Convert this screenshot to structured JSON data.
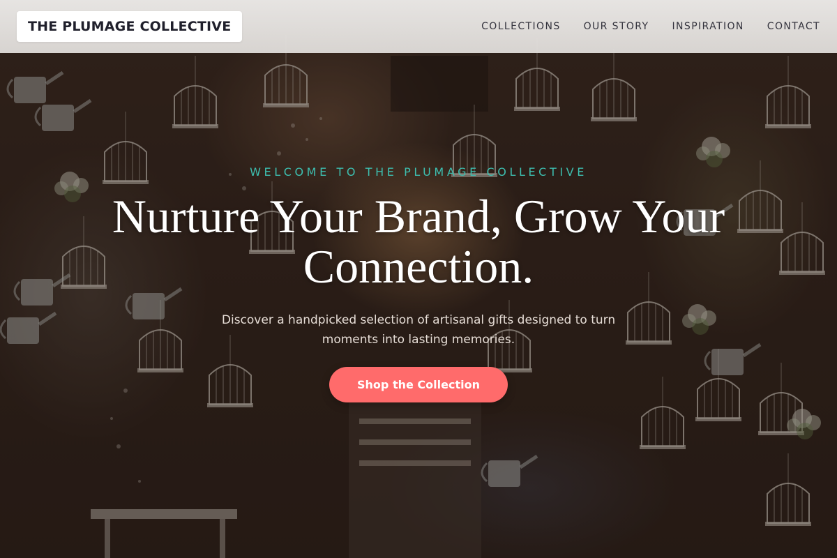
{
  "header": {
    "logo_text": "THE PLUMAGE COLLECTIVE",
    "nav": [
      {
        "label": "COLLECTIONS"
      },
      {
        "label": "OUR STORY"
      },
      {
        "label": "INSPIRATION"
      },
      {
        "label": "CONTACT"
      }
    ]
  },
  "hero": {
    "eyebrow": "WELCOME TO THE PLUMAGE COLLECTIVE",
    "headline": "Nurture Your Brand, Grow Your Connection.",
    "subtext": "Discover a handpicked selection of artisanal gifts designed to turn moments into lasting memories.",
    "cta_label": "Shop the Collection",
    "background_image": "shop-with-hanging-birdcages-and-watering-cans"
  },
  "colors": {
    "accent_teal": "#3dbfb0",
    "cta_coral": "#ff6b6b",
    "header_bg": "#e9e7e5",
    "logo_text": "#1f1f2b",
    "headline": "#ffffff"
  }
}
